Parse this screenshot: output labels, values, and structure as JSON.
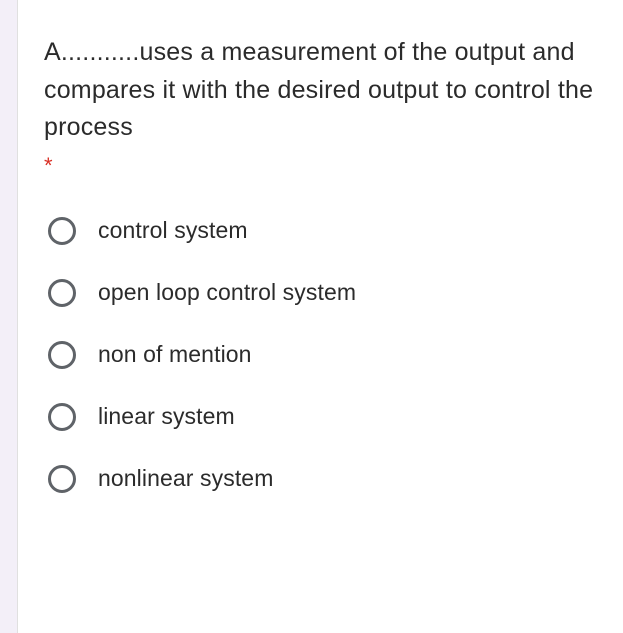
{
  "question": {
    "text": "A...........uses a measurement of the output and compares it with the desired output to control the process",
    "required_marker": "*"
  },
  "options": [
    {
      "label": "control system"
    },
    {
      "label": "open loop control system"
    },
    {
      "label": "non of mention"
    },
    {
      "label": "linear system"
    },
    {
      "label": "nonlinear system"
    }
  ]
}
